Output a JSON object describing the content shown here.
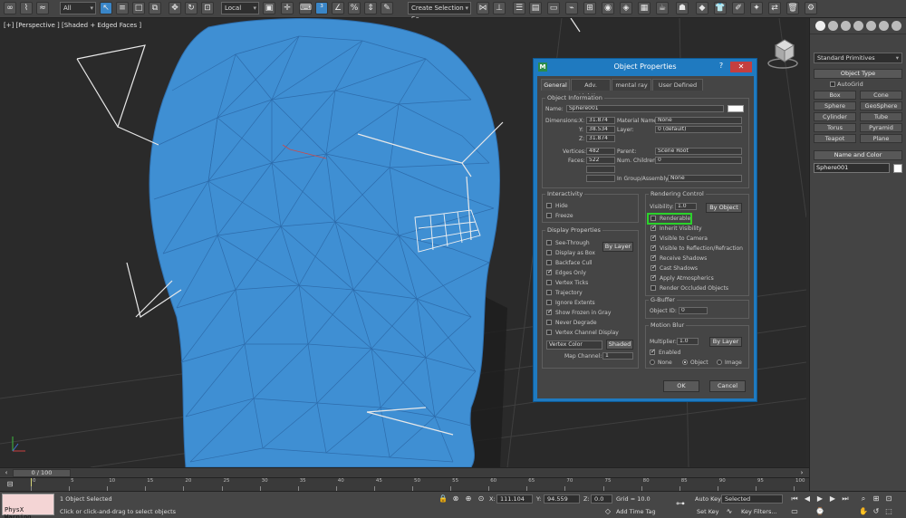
{
  "toolbar": {
    "selection_filter": "All",
    "reference_coord": "Local",
    "named_selection": "Create Selection Se"
  },
  "viewport": {
    "label": "[+] [Perspective ] [Shaded + Edged Faces ]"
  },
  "command_panel": {
    "category": "Standard Primitives",
    "object_type_title": "Object Type",
    "autogrid": "AutoGrid",
    "primitives": [
      "Box",
      "Cone",
      "Sphere",
      "GeoSphere",
      "Cylinder",
      "Tube",
      "Torus",
      "Pyramid",
      "Teapot",
      "Plane"
    ],
    "name_color_title": "Name and Color",
    "object_name": "Sphere001"
  },
  "dialog": {
    "title": "Object Properties",
    "logo": "M",
    "help": "?",
    "close": "✕",
    "tabs": [
      "General",
      "Adv. Lighting",
      "mental ray",
      "User Defined"
    ],
    "object_info": {
      "title": "Object Information",
      "name_label": "Name:",
      "name_value": "Sphere001",
      "dimensions_label": "Dimensions:",
      "x_label": "X:",
      "x": "31.874",
      "y_label": "Y:",
      "y": "38.534",
      "z_label": "Z:",
      "z": "31.874",
      "material_label": "Material Name:",
      "material": "None",
      "layer_label": "Layer:",
      "layer": "0 (default)",
      "vertices_label": "Vertices:",
      "vertices": "482",
      "faces_label": "Faces:",
      "faces": "522",
      "parent_label": "Parent:",
      "parent": "Scene Root",
      "children_label": "Num. Children:",
      "children": "0",
      "group_label": "In Group/Assembly:",
      "group": "None"
    },
    "interactivity": {
      "title": "Interactivity",
      "items": [
        {
          "label": "Hide",
          "checked": false
        },
        {
          "label": "Freeze",
          "checked": false
        }
      ]
    },
    "display": {
      "title": "Display Properties",
      "by_layer": "By Layer",
      "items": [
        {
          "label": "See-Through",
          "checked": false
        },
        {
          "label": "Display as Box",
          "checked": false
        },
        {
          "label": "Backface Cull",
          "checked": false
        },
        {
          "label": "Edges Only",
          "checked": true
        },
        {
          "label": "Vertex Ticks",
          "checked": false
        },
        {
          "label": "Trajectory",
          "checked": false
        },
        {
          "label": "Ignore Extents",
          "checked": false
        },
        {
          "label": "Show Frozen in Gray",
          "checked": true
        },
        {
          "label": "Never Degrade",
          "checked": false
        },
        {
          "label": "Vertex Channel Display",
          "checked": false
        }
      ],
      "vertex_color": "Vertex Color",
      "shaded": "Shaded",
      "map_channel_label": "Map Channel:",
      "map_channel": "1"
    },
    "rendering": {
      "title": "Rendering Control",
      "visibility_label": "Visibility:",
      "visibility": "1.0",
      "by_object": "By Object",
      "items": [
        {
          "label": "Renderable",
          "checked": false
        },
        {
          "label": "Inherit Visibility",
          "checked": true
        },
        {
          "label": "Visible to Camera",
          "checked": true
        },
        {
          "label": "Visible to Reflection/Refraction",
          "checked": true
        },
        {
          "label": "Receive Shadows",
          "checked": true
        },
        {
          "label": "Cast Shadows",
          "checked": true
        },
        {
          "label": "Apply Atmospherics",
          "checked": true
        },
        {
          "label": "Render Occluded Objects",
          "checked": false
        }
      ]
    },
    "gbuffer": {
      "title": "G-Buffer",
      "object_id_label": "Object ID:",
      "object_id": "0"
    },
    "motion_blur": {
      "title": "Motion Blur",
      "multiplier_label": "Multiplier:",
      "multiplier": "1.0",
      "by_layer": "By Layer",
      "enabled": "Enabled",
      "none": "None",
      "object": "Object",
      "image": "Image"
    },
    "ok": "OK",
    "cancel": "Cancel"
  },
  "timeline": {
    "position": "0 / 100",
    "ticks": [
      "0",
      "5",
      "10",
      "15",
      "20",
      "25",
      "30",
      "35",
      "40",
      "45",
      "50",
      "55",
      "60",
      "65",
      "70",
      "75",
      "80",
      "85",
      "90",
      "95",
      "100"
    ]
  },
  "status": {
    "physx": "PhysX Warning",
    "selected": "1 Object Selected",
    "hint": "Click or click-and-drag to select objects",
    "x_label": "X:",
    "x": "111.104",
    "y_label": "Y:",
    "y": "94.559",
    "z_label": "Z:",
    "z": "0.0",
    "grid": "Grid = 10.0",
    "add_time_tag": "Add Time Tag",
    "auto_key": "Auto Key",
    "auto_key_value": "Selected",
    "set_key": "Set Key",
    "key_filters": "Key Filters..."
  }
}
